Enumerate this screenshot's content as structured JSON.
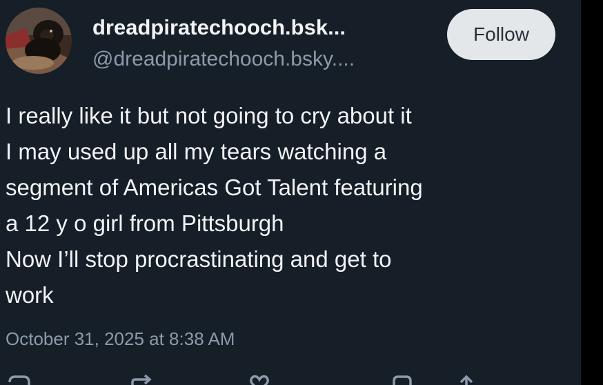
{
  "post": {
    "author": {
      "display_name": "dreadpiratechooch.bsk...",
      "handle": "@dreadpiratechooch.bsky...."
    },
    "follow_label": "Follow",
    "text_lines": [
      "I really like it but not going to cry about it",
      "I may used up all my tears watching a",
      "segment of Americas Got Talent featuring",
      "a 12 y o girl from Pittsburgh",
      "Now I’ll stop procrastinating and get to",
      "work"
    ],
    "timestamp": "October 31, 2025 at 8:38 AM"
  },
  "icons": {
    "avatar": "dog-photo",
    "reply": "reply-icon",
    "repost": "repost-icon",
    "like": "heart-icon",
    "bookmark": "bookmark-icon",
    "share": "share-icon"
  },
  "colors": {
    "background": "#161e27",
    "text_primary": "#f1f3f5",
    "text_secondary": "#8c9aab",
    "button_bg": "#e4e7ea"
  }
}
